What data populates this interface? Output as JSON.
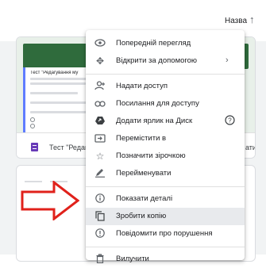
{
  "sort": {
    "label": "Назва",
    "arrow": "↑"
  },
  "file": {
    "thumb_title": "Тест \"Редагування му",
    "name": "Тест \"Редагув",
    "name_tail": "ати..."
  },
  "menu": {
    "items": [
      {
        "label": "Попередній перегляд",
        "icon": "eye-icon"
      },
      {
        "label": "Відкрити за допомогою",
        "icon": "move-icon"
      },
      {
        "label": "Надати доступ",
        "icon": "person-add-icon"
      },
      {
        "label": "Посилання для доступу",
        "icon": "link-icon"
      },
      {
        "label": "Додати ярлик на Диск",
        "icon": "drive-shortcut-icon"
      },
      {
        "label": "Перемістити в",
        "icon": "folder-move-icon"
      },
      {
        "label": "Позначити зірочкою",
        "icon": "star-icon"
      },
      {
        "label": "Перейменувати",
        "icon": "pencil-icon"
      },
      {
        "label": "Показати деталі",
        "icon": "info-icon"
      },
      {
        "label": "Зробити копію",
        "icon": "copy-icon"
      },
      {
        "label": "Повідомити про порушення",
        "icon": "report-icon"
      },
      {
        "label": "Вилучити",
        "icon": "trash-icon"
      }
    ],
    "submenu_chevron": "›",
    "help_symbol": "?"
  },
  "colors": {
    "highlight": "#e8eaed",
    "annotation_arrow": "#e0211b",
    "forms_purple": "#673ab7",
    "thumb_green": "#2f6b3c"
  }
}
